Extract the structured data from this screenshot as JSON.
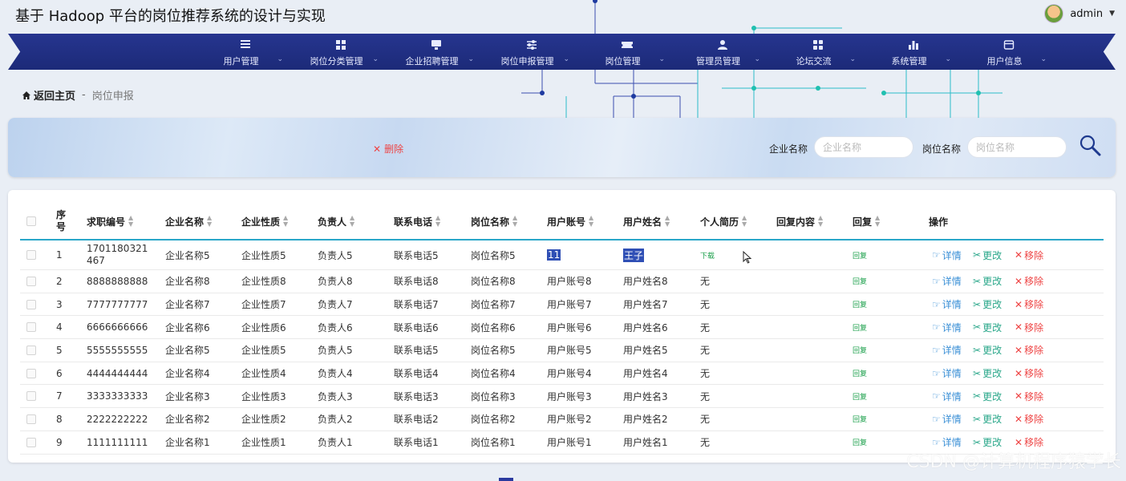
{
  "header": {
    "title": "基于 Hadoop 平台的岗位推荐系统的设计与实现",
    "user": "admin"
  },
  "nav": [
    {
      "label": "用户管理",
      "icon": "list-icon"
    },
    {
      "label": "岗位分类管理",
      "icon": "grid-icon"
    },
    {
      "label": "企业招聘管理",
      "icon": "monitor-icon"
    },
    {
      "label": "岗位申报管理",
      "icon": "sliders-icon"
    },
    {
      "label": "岗位管理",
      "icon": "ticket-icon"
    },
    {
      "label": "管理员管理",
      "icon": "person-icon"
    },
    {
      "label": "论坛交流",
      "icon": "apps-icon"
    },
    {
      "label": "系统管理",
      "icon": "bar-chart-icon"
    },
    {
      "label": "用户信息",
      "icon": "card-icon"
    }
  ],
  "breadcrumb": {
    "home": "返回主页",
    "separator": "-",
    "current": "岗位申报"
  },
  "search": {
    "delete_label": "删除",
    "company_label": "企业名称",
    "company_placeholder": "企业名称",
    "job_label": "岗位名称",
    "job_placeholder": "岗位名称"
  },
  "table": {
    "headers": {
      "index": "序号",
      "apply_no": "求职编号",
      "company": "企业名称",
      "nature": "企业性质",
      "owner": "负责人",
      "phone": "联系电话",
      "job": "岗位名称",
      "account": "用户账号",
      "username": "用户姓名",
      "resume": "个人简历",
      "reply_content": "回复内容",
      "reply": "回复",
      "ops": "操作"
    },
    "rows": [
      {
        "index": "1",
        "apply_no": "1701180321467",
        "company": "企业名称5",
        "nature": "企业性质5",
        "owner": "负责人5",
        "phone": "联系电话5",
        "job": "岗位名称5",
        "account": "11",
        "username": "王子",
        "resume": "下载",
        "reply_content": "",
        "reply": "回复"
      },
      {
        "index": "2",
        "apply_no": "8888888888",
        "company": "企业名称8",
        "nature": "企业性质8",
        "owner": "负责人8",
        "phone": "联系电话8",
        "job": "岗位名称8",
        "account": "用户账号8",
        "username": "用户姓名8",
        "resume": "无",
        "reply_content": "",
        "reply": "回复"
      },
      {
        "index": "3",
        "apply_no": "7777777777",
        "company": "企业名称7",
        "nature": "企业性质7",
        "owner": "负责人7",
        "phone": "联系电话7",
        "job": "岗位名称7",
        "account": "用户账号7",
        "username": "用户姓名7",
        "resume": "无",
        "reply_content": "",
        "reply": "回复"
      },
      {
        "index": "4",
        "apply_no": "6666666666",
        "company": "企业名称6",
        "nature": "企业性质6",
        "owner": "负责人6",
        "phone": "联系电话6",
        "job": "岗位名称6",
        "account": "用户账号6",
        "username": "用户姓名6",
        "resume": "无",
        "reply_content": "",
        "reply": "回复"
      },
      {
        "index": "5",
        "apply_no": "5555555555",
        "company": "企业名称5",
        "nature": "企业性质5",
        "owner": "负责人5",
        "phone": "联系电话5",
        "job": "岗位名称5",
        "account": "用户账号5",
        "username": "用户姓名5",
        "resume": "无",
        "reply_content": "",
        "reply": "回复"
      },
      {
        "index": "6",
        "apply_no": "4444444444",
        "company": "企业名称4",
        "nature": "企业性质4",
        "owner": "负责人4",
        "phone": "联系电话4",
        "job": "岗位名称4",
        "account": "用户账号4",
        "username": "用户姓名4",
        "resume": "无",
        "reply_content": "",
        "reply": "回复"
      },
      {
        "index": "7",
        "apply_no": "3333333333",
        "company": "企业名称3",
        "nature": "企业性质3",
        "owner": "负责人3",
        "phone": "联系电话3",
        "job": "岗位名称3",
        "account": "用户账号3",
        "username": "用户姓名3",
        "resume": "无",
        "reply_content": "",
        "reply": "回复"
      },
      {
        "index": "8",
        "apply_no": "2222222222",
        "company": "企业名称2",
        "nature": "企业性质2",
        "owner": "负责人2",
        "phone": "联系电话2",
        "job": "岗位名称2",
        "account": "用户账号2",
        "username": "用户姓名2",
        "resume": "无",
        "reply_content": "",
        "reply": "回复"
      },
      {
        "index": "9",
        "apply_no": "1111111111",
        "company": "企业名称1",
        "nature": "企业性质1",
        "owner": "负责人1",
        "phone": "联系电话1",
        "job": "岗位名称1",
        "account": "用户账号1",
        "username": "用户姓名1",
        "resume": "无",
        "reply_content": "",
        "reply": "回复"
      }
    ],
    "actions": {
      "view": "详情",
      "edit": "更改",
      "remove": "移除"
    }
  },
  "watermark": "CSDN @计算机程序猿学长",
  "colors": {
    "nav": "#1f2d80",
    "accent": "#2aa7c9",
    "danger": "#e44444",
    "reply": "#1a9f4a"
  }
}
